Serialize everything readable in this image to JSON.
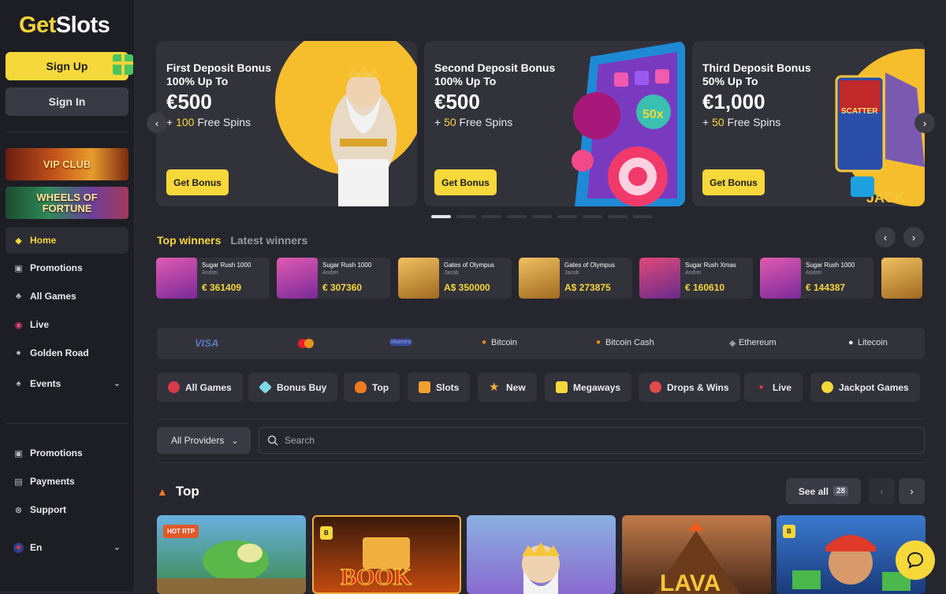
{
  "brand": {
    "part1": "Get",
    "part2": "Slots"
  },
  "auth": {
    "sign_up": "Sign Up",
    "sign_in": "Sign In"
  },
  "banners": {
    "vip": "VIP CLUB",
    "wheels": "WHEELS OF FORTUNE"
  },
  "sidebar": {
    "items": [
      {
        "label": "Home",
        "icon": "home-icon"
      },
      {
        "label": "Promotions",
        "icon": "gift-icon"
      },
      {
        "label": "All Games",
        "icon": "cards-icon"
      },
      {
        "label": "Live",
        "icon": "live-icon"
      },
      {
        "label": "Golden Road",
        "icon": "road-icon"
      },
      {
        "label": "Events",
        "icon": "spade-icon"
      }
    ],
    "bottom": [
      {
        "label": "Promotions",
        "icon": "gift-icon"
      },
      {
        "label": "Payments",
        "icon": "wallet-icon"
      },
      {
        "label": "Support",
        "icon": "lifebuoy-icon"
      }
    ],
    "language": "En"
  },
  "promos": [
    {
      "title": "First Deposit Bonus",
      "subtitle": "100% Up To",
      "amount": "€500",
      "spins_prefix": "+ ",
      "spins": "100",
      "spins_suffix": " Free Spins",
      "cta": "Get Bonus"
    },
    {
      "title": "Second Deposit Bonus",
      "subtitle": "100% Up To",
      "amount": "€500",
      "spins_prefix": "+ ",
      "spins": "50",
      "spins_suffix": " Free Spins",
      "cta": "Get Bonus"
    },
    {
      "title": "Third Deposit Bonus",
      "subtitle": "50% Up To",
      "amount": "€1,000",
      "spins_prefix": "+ ",
      "spins": "50",
      "spins_suffix": " Free Spins",
      "cta": "Get Bonus"
    }
  ],
  "winners": {
    "tab_top": "Top winners",
    "tab_latest": "Latest winners",
    "list": [
      {
        "game": "Sugar Rush 1000",
        "user": "Andrei",
        "amount": "€ 361409",
        "color": "#b0389a"
      },
      {
        "game": "Sugar Rush 1000",
        "user": "Andrei",
        "amount": "€ 307360",
        "color": "#b0389a"
      },
      {
        "game": "Gates of Olympus",
        "user": "Jacob",
        "amount": "A$ 350000",
        "color": "#e7b03a"
      },
      {
        "game": "Gates of Olympus",
        "user": "Jacob",
        "amount": "A$ 273875",
        "color": "#e7b03a"
      },
      {
        "game": "Sugar Rush Xmas",
        "user": "Andrei",
        "amount": "€ 160610",
        "color": "#d03a6a"
      },
      {
        "game": "Sugar Rush 1000",
        "user": "Andrei",
        "amount": "€ 144387",
        "color": "#b0389a"
      }
    ]
  },
  "payments": [
    "VISA",
    "",
    "Maestro",
    "Bitcoin",
    "Bitcoin Cash",
    "Ethereum",
    "Litecoin"
  ],
  "categories": [
    {
      "label": "All Games",
      "color": "#d63a4a"
    },
    {
      "label": "Bonus Buy",
      "color": "#7fd6e6"
    },
    {
      "label": "Top",
      "color": "#f07a22"
    },
    {
      "label": "Slots",
      "color": "#f0a030"
    },
    {
      "label": "New",
      "color": "#f0b040"
    },
    {
      "label": "Megaways",
      "color": "#f6d83b"
    },
    {
      "label": "Drops & Wins",
      "color": "#e04a4a"
    },
    {
      "label": "Live",
      "color": "#e03a3a"
    },
    {
      "label": "Jackpot Games",
      "color": "#f6d83b"
    }
  ],
  "filters": {
    "providers": "All Providers",
    "search_placeholder": "Search"
  },
  "top_section": {
    "title": "Top",
    "see_all": "See all",
    "count": "28"
  },
  "games": [
    {
      "badge": "HOT RTP",
      "name": "bass-fishing",
      "bg": "#3a8ad0"
    },
    {
      "badge": "B",
      "name": "book-of",
      "bg": "#c24a10"
    },
    {
      "badge": "",
      "name": "gates-of-olympus",
      "bg": "#8a6ad0"
    },
    {
      "badge": "",
      "name": "lava",
      "bg": "#7a4a2a"
    },
    {
      "badge": "B",
      "name": "money-man",
      "bg": "#3a7ad0"
    }
  ]
}
